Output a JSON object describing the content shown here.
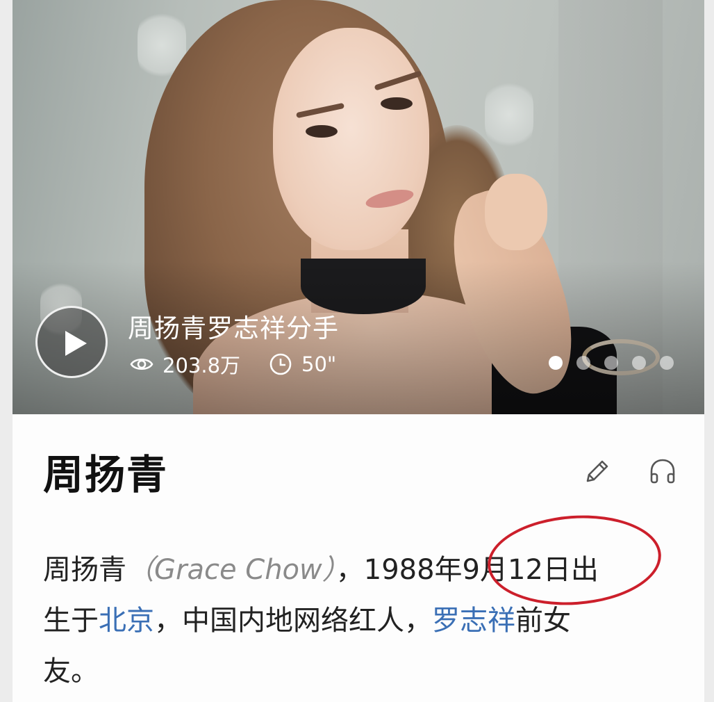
{
  "video": {
    "title": "周扬青罗志祥分手",
    "views": "203.8万",
    "duration": "50\"",
    "slides_total": 5,
    "active_slide": 1
  },
  "entry": {
    "title": "周扬青",
    "summary_name": "周扬青",
    "summary_en": "（Grace Chow）",
    "summary_comma": "，",
    "summary_pre_circle": "1988年",
    "summary_circled": "9月12日出",
    "summary_line2_a": "生于",
    "link_beijing": "北京",
    "summary_line2_b": "，中国内地网络红人，",
    "link_luozhixiang": "罗志祥",
    "summary_line2_c": "前女",
    "summary_line3": "友。"
  },
  "icons": {
    "play": "play-icon",
    "views": "eye-icon",
    "duration": "clock-icon",
    "edit": "pencil-icon",
    "audio": "headphones-icon"
  },
  "colors": {
    "link": "#3a6fb5",
    "annotation": "#cc1f2b"
  }
}
